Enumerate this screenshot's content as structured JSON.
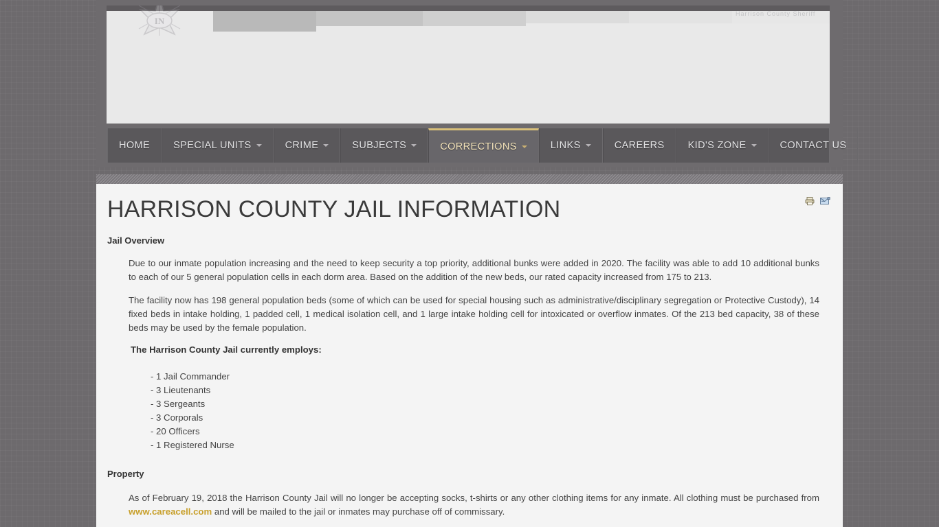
{
  "site": {
    "logo_alt": "sheriff-star-badge",
    "badge_text": "IN",
    "ghost_text": "Harrison County Sheriff"
  },
  "nav": {
    "items": [
      {
        "label": "HOME",
        "has_caret": false,
        "active": false
      },
      {
        "label": "SPECIAL UNITS",
        "has_caret": true,
        "active": false
      },
      {
        "label": "CRIME",
        "has_caret": true,
        "active": false
      },
      {
        "label": "SUBJECTS",
        "has_caret": true,
        "active": false
      },
      {
        "label": "CORRECTIONS",
        "has_caret": true,
        "active": true
      },
      {
        "label": "LINKS",
        "has_caret": true,
        "active": false
      },
      {
        "label": "CAREERS",
        "has_caret": false,
        "active": false
      },
      {
        "label": "KID'S ZONE",
        "has_caret": true,
        "active": false
      },
      {
        "label": "CONTACT US",
        "has_caret": false,
        "active": false
      }
    ],
    "active_accent_color": "#d9c07a"
  },
  "article": {
    "title": "HARRISON COUNTY JAIL INFORMATION",
    "actions": [
      {
        "name": "print-icon",
        "title": "Print"
      },
      {
        "name": "email-icon",
        "title": "Email"
      }
    ],
    "section_overview_heading": "Jail Overview",
    "paragraph_1": "Due to our inmate population increasing and the need to keep security a top priority, additional bunks were added in 2020. The facility was able to add 10 additional bunks to each of our 5 general population cells in each dorm area. Based on the addition of the new beds, our rated capacity increased from 175 to 213.",
    "paragraph_2": "The facility now has 198 general population beds (some of which can be used for special housing such as administrative/disciplinary segregation or Protective Custody), 14 fixed beds in intake holding, 1 padded cell, 1 medical isolation cell, and 1 large intake holding cell for intoxicated or overflow inmates.  Of the 213 bed capacity, 38 of these beds may be used by the female population.",
    "employs_heading": "The Harrison County Jail currently employs:",
    "staff": [
      "- 1 Jail Commander",
      "- 3 Lieutenants",
      "- 3 Sergeants",
      "- 3 Corporals",
      "- 20 Officers",
      "- 1 Registered Nurse"
    ],
    "section_property_heading": "Property",
    "property_text_before_link": "As of February 19, 2018 the Harrison County Jail will no longer be accepting socks, t-shirts or any other clothing items for any inmate. All clothing must be purchased from ",
    "property_link_text": "www.careacell.com",
    "property_text_after_link": " and will be mailed to the jail or inmates may purchase off of commissary.",
    "link_color": "#c8a02c"
  }
}
